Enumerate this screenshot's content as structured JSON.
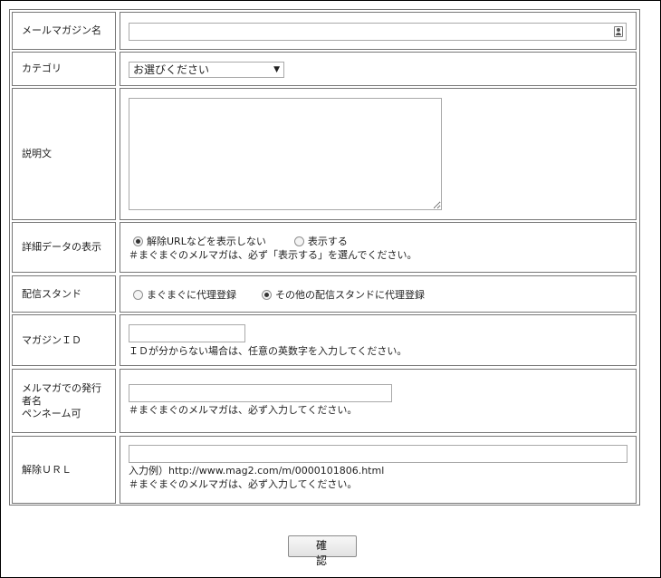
{
  "form": {
    "magazine_name": {
      "label": "メールマガジン名",
      "value": ""
    },
    "category": {
      "label": "カテゴリ",
      "selected": "お選びください"
    },
    "description": {
      "label": "説明文",
      "value": ""
    },
    "detail_display": {
      "label": "詳細データの表示",
      "options": [
        "解除URLなどを表示しない",
        "表示する"
      ],
      "selected_index": 0,
      "note": "＃まぐまぐのメルマガは、必ず「表示する」を選んでください。"
    },
    "delivery_stand": {
      "label": "配信スタンド",
      "options": [
        "まぐまぐに代理登録",
        "その他の配信スタンドに代理登録"
      ],
      "selected_index": 1
    },
    "magazine_id": {
      "label": "マガジンＩＤ",
      "value": "",
      "note": "ＩＤが分からない場合は、任意の英数字を入力してください。"
    },
    "publisher": {
      "label_lines": [
        "メルマガでの発行",
        "者名",
        "ペンネーム可"
      ],
      "value": "",
      "note": "＃まぐまぐのメルマガは、必ず入力してください。"
    },
    "unsubscribe_url": {
      "label": "解除ＵＲＬ",
      "value": "",
      "example": "入力例）http://www.mag2.com/m/0000101806.html",
      "note": "＃まぐまぐのメルマガは、必ず入力してください。"
    }
  },
  "confirm_button": "確　認",
  "icons": {
    "input_assist": "person-card-icon",
    "select_arrow": "triangle-down-icon"
  }
}
